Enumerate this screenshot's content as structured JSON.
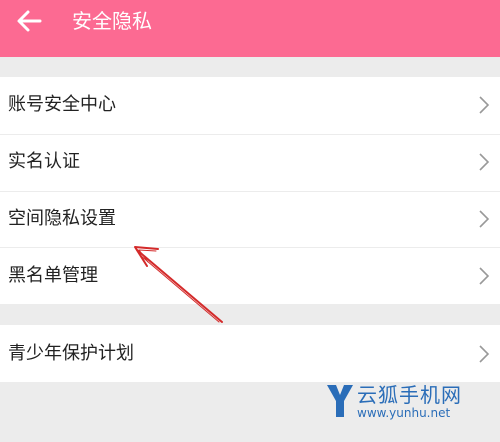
{
  "header": {
    "title": "安全隐私",
    "back_icon": "arrow-left-icon",
    "background": "#fc6a92"
  },
  "menu": {
    "group1": [
      {
        "label": "账号安全中心"
      },
      {
        "label": "实名认证"
      },
      {
        "label": "空间隐私设置"
      },
      {
        "label": "黑名单管理"
      }
    ],
    "group2": [
      {
        "label": "青少年保护计划"
      }
    ],
    "chevron_icon": "chevron-right-icon"
  },
  "annotation": {
    "arrow_color": "#d42a2a"
  },
  "watermark": {
    "brand": "云狐手机网",
    "url": "www.yunhu.net",
    "color": "#2a6db8"
  }
}
